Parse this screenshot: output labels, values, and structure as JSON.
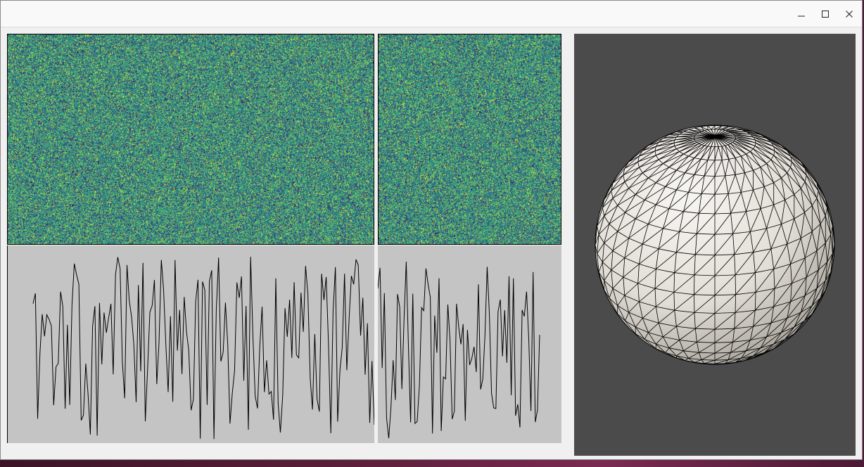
{
  "window": {
    "title": "",
    "controls": {
      "minimize": "minimize-icon",
      "maximize": "maximize-icon",
      "close": "close-icon"
    }
  },
  "panels": {
    "heatmaps": {
      "colormap": "viridis",
      "background": "#440154"
    },
    "waveforms": {
      "background": "#c4c4c4",
      "line_color": "#000000"
    },
    "view3d": {
      "background": "#4b4b4b",
      "object": "wireframe-sphere",
      "fill": "#e6e2dc",
      "edge_color": "#000000"
    }
  },
  "colors": {
    "window_bg": "#f0f0f0",
    "titlebar_bg": "#f9f9f9"
  }
}
